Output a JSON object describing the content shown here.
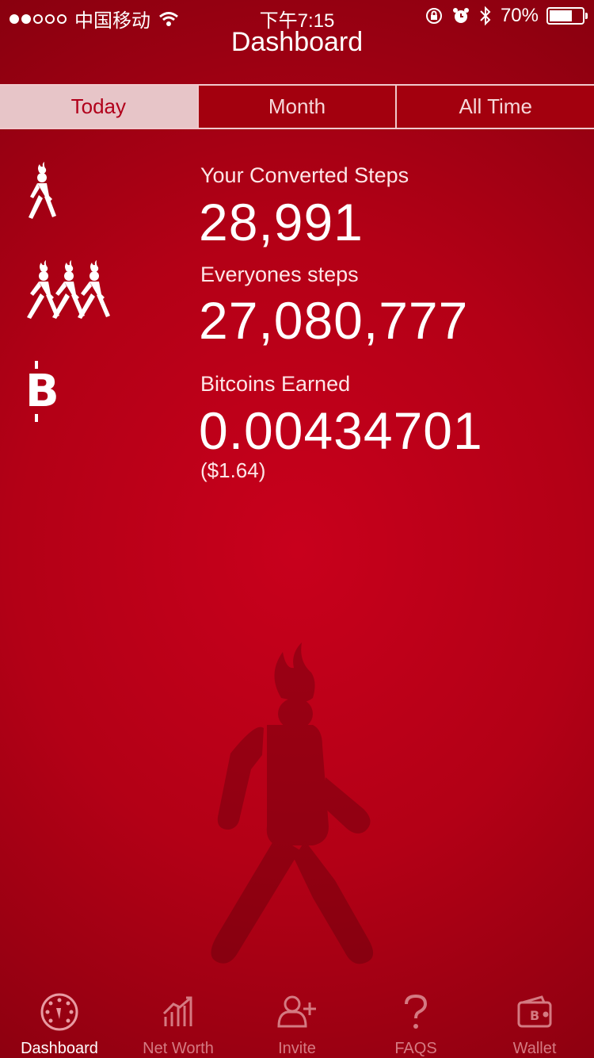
{
  "status_bar": {
    "carrier": "中国移动",
    "time": "下午7:15",
    "battery_percent": "70%",
    "battery_level": 0.7,
    "signal_strength": 2
  },
  "nav": {
    "title": "Dashboard"
  },
  "period_tabs": [
    {
      "label": "Today",
      "active": true
    },
    {
      "label": "Month",
      "active": false
    },
    {
      "label": "All Time",
      "active": false
    }
  ],
  "stats": {
    "your_steps": {
      "label": "Your Converted Steps",
      "value": "28,991"
    },
    "everyone_steps": {
      "label": "Everyones steps",
      "value": "27,080,777"
    },
    "bitcoins": {
      "label": "Bitcoins Earned",
      "value": "0.00434701",
      "fiat": "($1.64)"
    }
  },
  "tabbar": [
    {
      "label": "Dashboard",
      "icon": "dashboard-gauge-icon",
      "active": true
    },
    {
      "label": "Net Worth",
      "icon": "bar-chart-icon",
      "active": false
    },
    {
      "label": "Invite",
      "icon": "add-user-icon",
      "active": false
    },
    {
      "label": "FAQS",
      "icon": "question-icon",
      "active": false
    },
    {
      "label": "Wallet",
      "icon": "wallet-icon",
      "active": false
    }
  ],
  "colors": {
    "background": "#b30016",
    "active_tab_bg": "#e7c5c8",
    "active_tab_text": "#b1001a",
    "inactive_tabbar": "#d47a82"
  }
}
